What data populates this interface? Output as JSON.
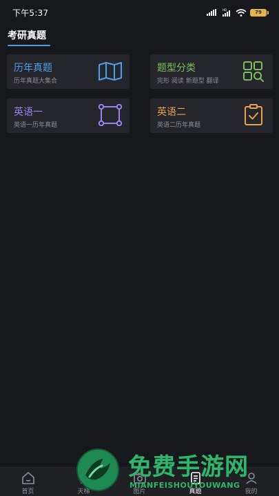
{
  "status_bar": {
    "time": "下午5:37",
    "battery": "79"
  },
  "header": {
    "tab_label": "考研真题"
  },
  "cards": [
    {
      "title": "历年真题",
      "subtitle": "历年真题大集合",
      "icon": "map-icon",
      "color": "#4f9ee8"
    },
    {
      "title": "题型分类",
      "subtitle": "完形 阅读 新题型 翻译",
      "icon": "grid-search-icon",
      "color": "#7cc05a"
    },
    {
      "title": "英语一",
      "subtitle": "英语一历年真题",
      "icon": "select-frame-icon",
      "color": "#9b82f0"
    },
    {
      "title": "英语二",
      "subtitle": "英语二历年真题",
      "icon": "clipboard-check-icon",
      "color": "#e8a24a"
    }
  ],
  "bottom_nav": [
    {
      "label": "首页",
      "icon": "home-icon",
      "active": false
    },
    {
      "label": "天梯",
      "icon": "ladder-icon",
      "active": false
    },
    {
      "label": "图片",
      "icon": "camera-icon",
      "active": false
    },
    {
      "label": "真题",
      "icon": "document-icon",
      "active": true
    },
    {
      "label": "我的",
      "icon": "user-icon",
      "active": false
    }
  ],
  "watermark": {
    "cn": "免费手游网",
    "en": "MIANFEISHOUYOUWANG"
  }
}
